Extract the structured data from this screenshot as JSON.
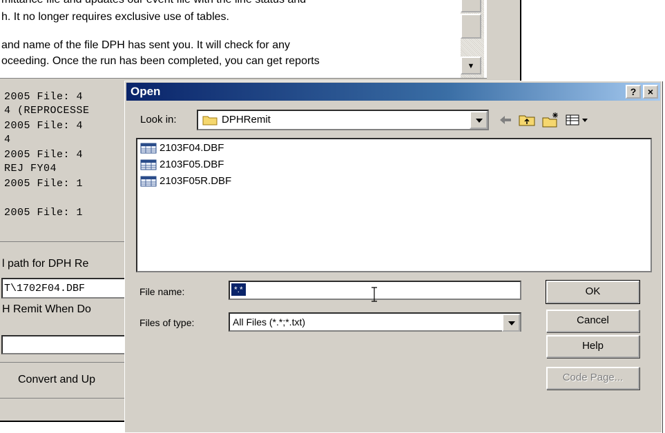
{
  "background": {
    "description_lines": [
      "mittance file and updates our event file with the line status and",
      "h.  It no longer requires exclusive use of tables.",
      "and name of the file DPH has sent you.  It will check for any",
      "oceeding.  Once the run has been completed, you can get reports"
    ],
    "log_lines": [
      "2005  File: 4",
      "4 (REPROCESSE",
      "2005  File: 4",
      "4",
      "2005  File: 4",
      "REJ FY04",
      "2005  File: 1",
      "2005  File: 1"
    ],
    "path_label": "l path for DPH Re",
    "path_value": "T\\1702F04.DBF",
    "remit_label": "H Remit When Do",
    "convert_button": "Convert and Up"
  },
  "dialog": {
    "title": "Open",
    "help_btn": "?",
    "close_btn": "×",
    "look_in_label": "Look in:",
    "look_in_value": "DPHRemit",
    "files": [
      {
        "name": "2103F04.DBF"
      },
      {
        "name": "2103F05.DBF"
      },
      {
        "name": "2103F05R.DBF"
      }
    ],
    "file_name_label": "File name:",
    "file_name_value": "*.*",
    "files_of_type_label": "Files of type:",
    "files_of_type_value": "All Files (*.*;*.txt)",
    "ok_button": "OK",
    "cancel_button": "Cancel",
    "help_button": "Help",
    "code_page_button": "Code Page..."
  },
  "colors": {
    "title_bar": "#0a246a",
    "dialog_face": "#d4d0c8",
    "selection": "#0a246a"
  },
  "icons": [
    "folder-icon",
    "back-arrow-icon",
    "up-folder-icon",
    "new-folder-icon",
    "view-menu-icon",
    "dbf-file-icon",
    "i-beam-cursor-icon"
  ]
}
